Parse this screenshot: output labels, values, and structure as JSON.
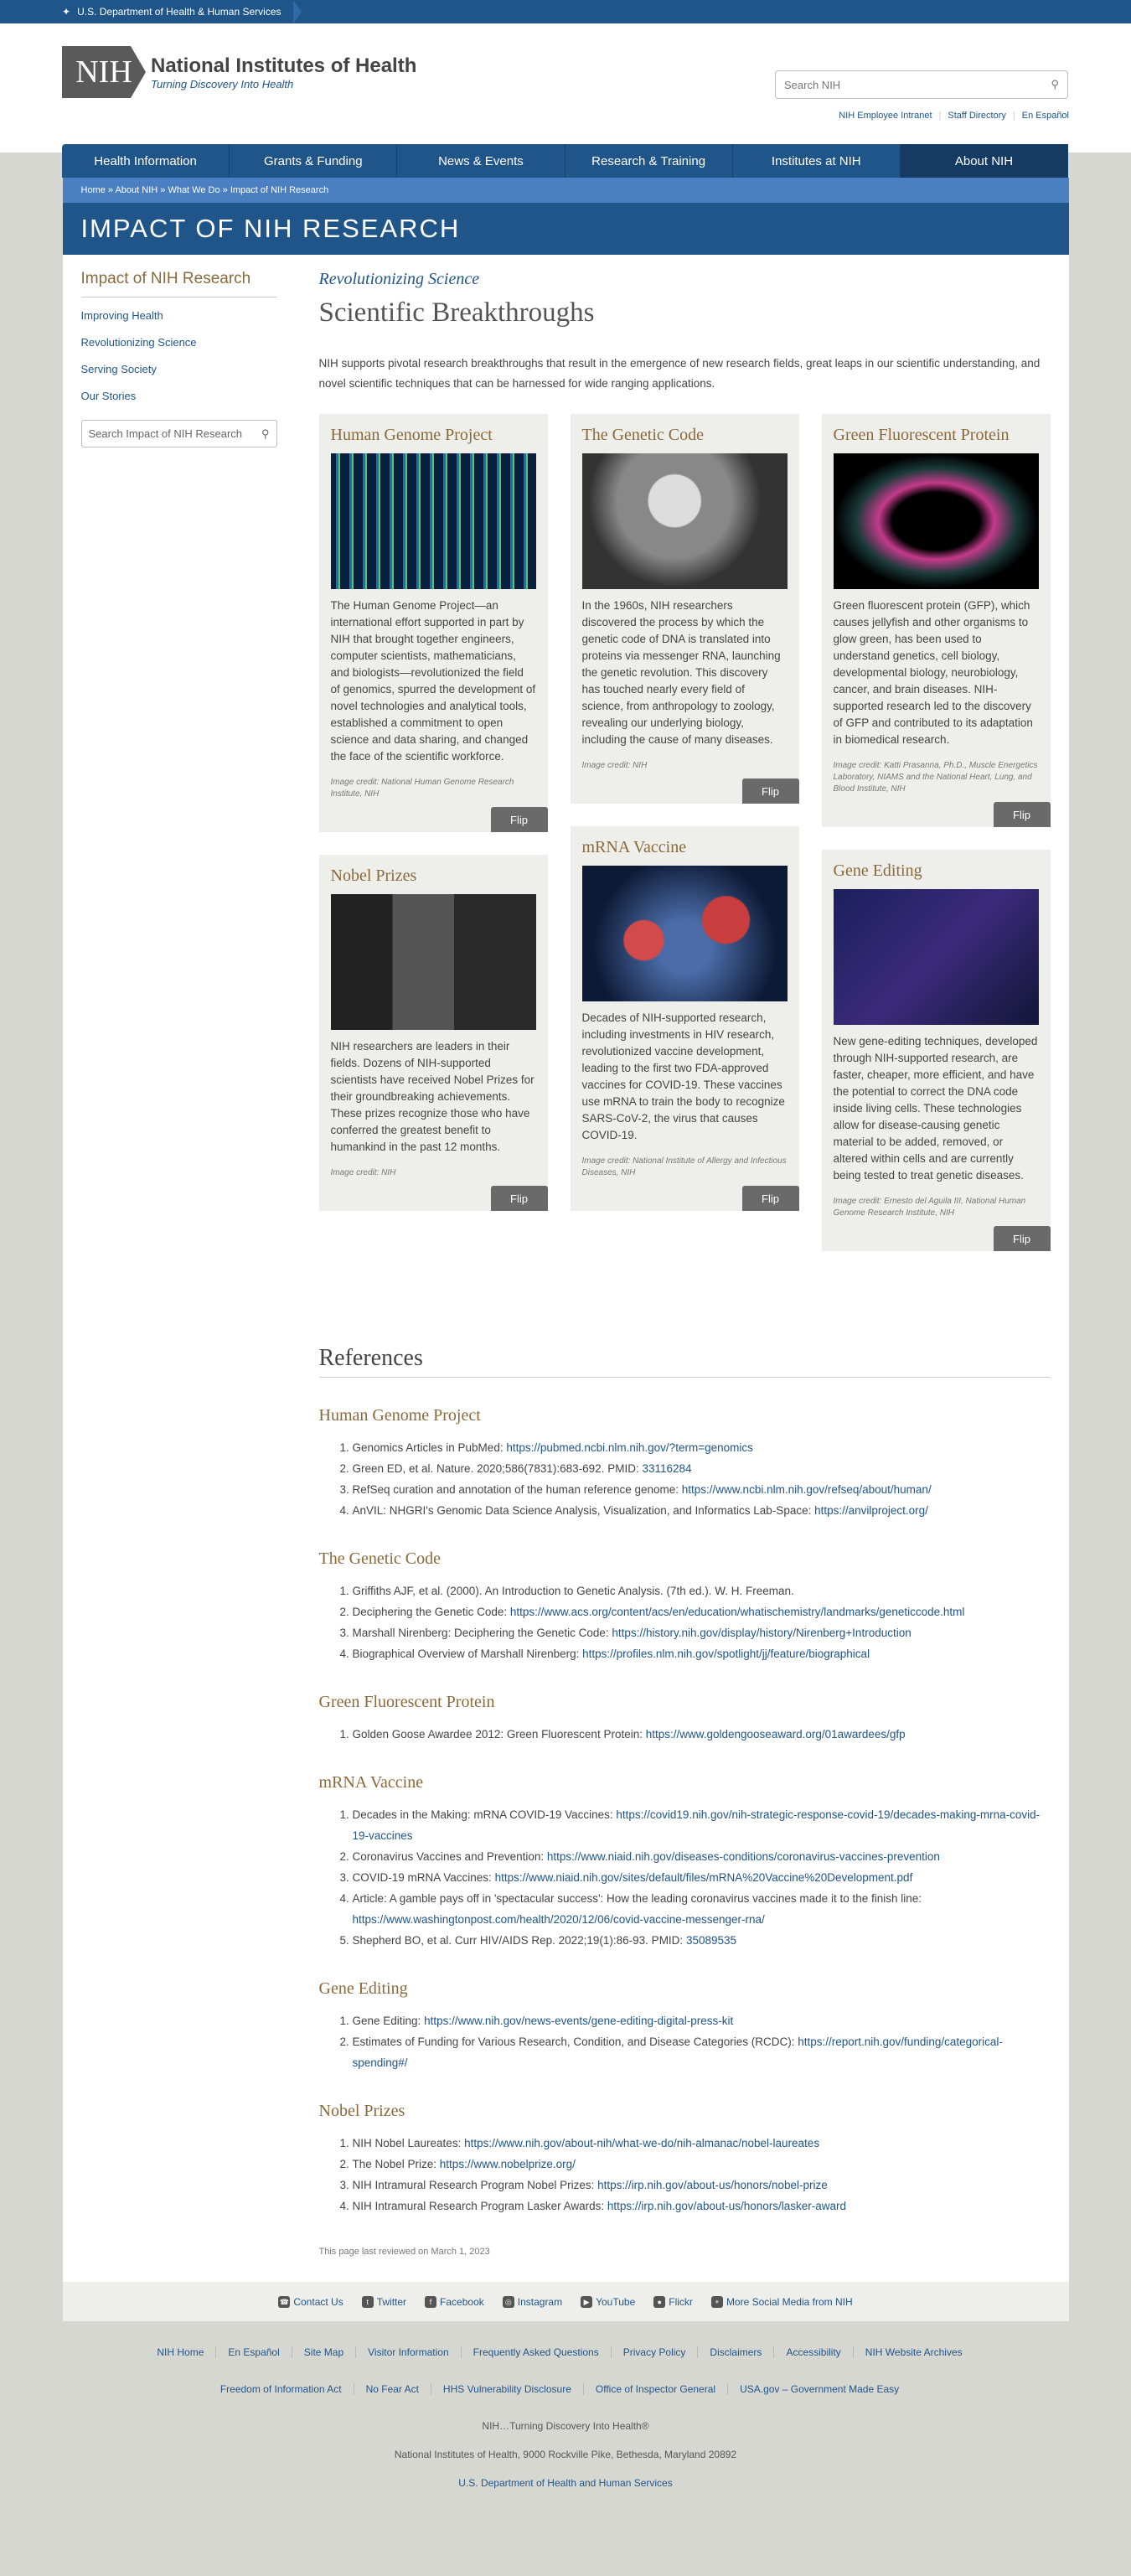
{
  "topbar": {
    "label": "U.S. Department of Health & Human Services"
  },
  "header": {
    "logo_abbr": "NIH",
    "title": "National Institutes of Health",
    "tagline": "Turning Discovery Into Health",
    "search_placeholder": "Search NIH",
    "util": [
      "NIH Employee Intranet",
      "Staff Directory",
      "En Español"
    ]
  },
  "nav": [
    "Health Information",
    "Grants & Funding",
    "News & Events",
    "Research & Training",
    "Institutes at NIH",
    "About NIH"
  ],
  "breadcrumb": "Home » About NIH » What We Do » Impact of NIH Research",
  "banner": "IMPACT OF NIH RESEARCH",
  "sidebar": {
    "title": "Impact of NIH Research",
    "links": [
      "Improving Health",
      "Revolutionizing Science",
      "Serving Society",
      "Our Stories"
    ],
    "search_placeholder": "Search Impact of NIH Research"
  },
  "main": {
    "kicker": "Revolutionizing Science",
    "title": "Scientific Breakthroughs",
    "intro": "NIH supports pivotal research breakthroughs that result in the emergence of new research fields, great leaps in our scientific understanding, and novel scientific techniques that can be harnessed for wide ranging applications."
  },
  "flip_label": "Flip",
  "cards": {
    "genome": {
      "title": "Human Genome Project",
      "text": "The Human Genome Project—an international effort supported in part by NIH that brought together engineers, computer scientists, mathematicians, and biologists—revolutionized the field of genomics, spurred the development of novel technologies and analytical tools, established a commitment to open science and data sharing, and changed the face of the scientific workforce.",
      "credit": "Image credit: National Human Genome Research Institute, NIH"
    },
    "nobel": {
      "title": "Nobel Prizes",
      "text": "NIH researchers are leaders in their fields. Dozens of NIH-supported scientists have received Nobel Prizes for their groundbreaking achievements. These prizes recognize those who have conferred the greatest benefit to humankind in the past 12 months.",
      "credit": "Image credit: NIH"
    },
    "code": {
      "title": "The Genetic Code",
      "text": "In the 1960s, NIH researchers discovered the process by which the genetic code of DNA is translated into proteins via messenger RNA, launching the genetic revolution. This discovery has touched nearly every field of science, from anthropology to zoology, revealing our underlying biology, including the cause of many diseases.",
      "credit": "Image credit: NIH"
    },
    "mrna": {
      "title": "mRNA Vaccine",
      "text": "Decades of NIH-supported research, including investments in HIV research, revolutionized vaccine development, leading to the first two FDA-approved vaccines for COVID-19. These vaccines use mRNA to train the body to recognize SARS-CoV-2, the virus that causes COVID-19.",
      "credit": "Image credit: National Institute of Allergy and Infectious Diseases, NIH"
    },
    "gfp": {
      "title": "Green Fluorescent Protein",
      "text": "Green fluorescent protein (GFP), which causes jellyfish and other organisms to glow green, has been used to understand genetics, cell biology, developmental biology, neurobiology, cancer, and brain diseases. NIH-supported research led to the discovery of GFP and contributed to its adaptation in biomedical research.",
      "credit": "Image credit: Katti Prasanna, Ph.D., Muscle Energetics Laboratory, NIAMS and the National Heart, Lung, and Blood Institute, NIH"
    },
    "editing": {
      "title": "Gene Editing",
      "text": "New gene-editing techniques, developed through NIH-supported research, are faster, cheaper, more efficient, and have the potential to correct the DNA code inside living cells. These technologies allow for disease-causing genetic material to be added, removed, or altered within cells and are currently being tested to treat genetic diseases.",
      "credit": "Image credit: Ernesto del Aguila III, National Human Genome Research Institute, NIH"
    }
  },
  "references": {
    "title": "References",
    "groups": [
      {
        "title": "Human Genome Project",
        "items": [
          [
            "Genomics Articles in PubMed: ",
            "https://pubmed.ncbi.nlm.nih.gov/?term=genomics"
          ],
          [
            "Green ED, et al. Nature. 2020;586(7831):683-692. PMID: ",
            "33116284"
          ],
          [
            "RefSeq curation and annotation of the human reference genome: ",
            "https://www.ncbi.nlm.nih.gov/refseq/about/human/"
          ],
          [
            "AnVIL: NHGRI's Genomic Data Science Analysis, Visualization, and Informatics Lab-Space: ",
            "https://anvilproject.org/"
          ]
        ]
      },
      {
        "title": "The Genetic Code",
        "items": [
          [
            "Griffiths AJF, et al. (2000). An Introduction to Genetic Analysis. (7th ed.). W. H. Freeman.",
            ""
          ],
          [
            "Deciphering the Genetic Code: ",
            "https://www.acs.org/content/acs/en/education/whatischemistry/landmarks/geneticcode.html"
          ],
          [
            "Marshall Nirenberg: Deciphering the Genetic Code: ",
            "https://history.nih.gov/display/history/Nirenberg+Introduction"
          ],
          [
            "Biographical Overview of Marshall Nirenberg: ",
            "https://profiles.nlm.nih.gov/spotlight/jj/feature/biographical"
          ]
        ]
      },
      {
        "title": "Green Fluorescent Protein",
        "items": [
          [
            "Golden Goose Awardee 2012: Green Fluorescent Protein: ",
            "https://www.goldengooseaward.org/01awardees/gfp"
          ]
        ]
      },
      {
        "title": "mRNA Vaccine",
        "items": [
          [
            "Decades in the Making: mRNA COVID-19 Vaccines: ",
            "https://covid19.nih.gov/nih-strategic-response-covid-19/decades-making-mrna-covid-19-vaccines"
          ],
          [
            "Coronavirus Vaccines and Prevention: ",
            "https://www.niaid.nih.gov/diseases-conditions/coronavirus-vaccines-prevention"
          ],
          [
            "COVID-19 mRNA Vaccines: ",
            "https://www.niaid.nih.gov/sites/default/files/mRNA%20Vaccine%20Development.pdf"
          ],
          [
            "Article: A gamble pays off in 'spectacular success': How the leading coronavirus vaccines made it to the finish line: ",
            "https://www.washingtonpost.com/health/2020/12/06/covid-vaccine-messenger-rna/"
          ],
          [
            "Shepherd BO, et al. Curr HIV/AIDS Rep. 2022;19(1):86-93. PMID: ",
            "35089535"
          ]
        ]
      },
      {
        "title": "Gene Editing",
        "items": [
          [
            "Gene Editing: ",
            "https://www.nih.gov/news-events/gene-editing-digital-press-kit"
          ],
          [
            "Estimates of Funding for Various Research, Condition, and Disease Categories (RCDC): ",
            "https://report.nih.gov/funding/categorical-spending#/"
          ]
        ]
      },
      {
        "title": "Nobel Prizes",
        "items": [
          [
            "NIH Nobel Laureates: ",
            "https://www.nih.gov/about-nih/what-we-do/nih-almanac/nobel-laureates"
          ],
          [
            "The Nobel Prize: ",
            "https://www.nobelprize.org/"
          ],
          [
            "NIH Intramural Research Program Nobel Prizes: ",
            "https://irp.nih.gov/about-us/honors/nobel-prize"
          ],
          [
            "NIH Intramural Research Program Lasker Awards: ",
            "https://irp.nih.gov/about-us/honors/lasker-award"
          ]
        ]
      }
    ]
  },
  "reviewed": "This page last reviewed on March 1, 2023",
  "social": [
    "Contact Us",
    "Twitter",
    "Facebook",
    "Instagram",
    "YouTube",
    "Flickr",
    "More Social Media from NIH"
  ],
  "footer": {
    "row1": [
      "NIH Home",
      "En Español",
      "Site Map",
      "Visitor Information",
      "Frequently Asked Questions",
      "Privacy Policy",
      "Disclaimers",
      "Accessibility",
      "NIH Website Archives"
    ],
    "row2": [
      "Freedom of Information Act",
      "No Fear Act",
      "HHS Vulnerability Disclosure",
      "Office of Inspector General",
      "USA.gov – Government Made Easy"
    ],
    "tagline": "NIH…Turning Discovery Into Health®",
    "address": "National Institutes of Health, 9000 Rockville Pike, Bethesda, Maryland 20892",
    "hhs": "U.S. Department of Health and Human Services"
  }
}
